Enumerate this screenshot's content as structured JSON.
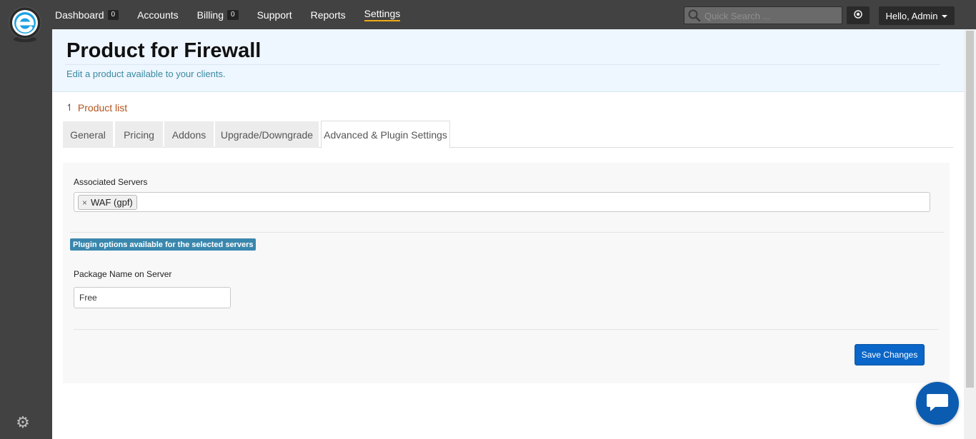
{
  "colors": {
    "accent": "#0a66c8",
    "nav_active_underline": "#f0a818",
    "info_badge": "#3a87ad",
    "link": "#b3541e",
    "subtitle": "#3a8aa0",
    "chat": "#0b5cb0"
  },
  "icons": {
    "logo": "e-logo-icon",
    "search": "magnifier-icon",
    "control": "target-icon",
    "settings": "gear-icon",
    "chat": "chat-bubble-icon",
    "breadcrumb": "up-arrow-icon",
    "remove": "close-icon"
  },
  "nav": {
    "items": [
      {
        "label": "Dashboard",
        "badge": "0",
        "active": false
      },
      {
        "label": "Accounts",
        "badge": null,
        "active": false
      },
      {
        "label": "Billing",
        "badge": "0",
        "active": false
      },
      {
        "label": "Support",
        "badge": null,
        "active": false
      },
      {
        "label": "Reports",
        "badge": null,
        "active": false
      },
      {
        "label": "Settings",
        "badge": null,
        "active": true
      }
    ],
    "search_placeholder": "Quick Search ...",
    "user_label": "Hello, Admin"
  },
  "header": {
    "title": "Product for Firewall",
    "subtitle": "Edit a product available to your clients."
  },
  "breadcrumb": {
    "arrow": "↿",
    "label": "Product list"
  },
  "tabs": [
    {
      "label": "General",
      "active": false
    },
    {
      "label": "Pricing",
      "active": false
    },
    {
      "label": "Addons",
      "active": false
    },
    {
      "label": "Upgrade/Downgrade",
      "active": false
    },
    {
      "label": "Advanced & Plugin Settings",
      "active": true
    }
  ],
  "form": {
    "servers_label": "Associated Servers",
    "servers_selected": [
      {
        "label": "WAF (gpf)",
        "remove_glyph": "×"
      }
    ],
    "plugin_badge": "Plugin options available for the selected servers",
    "package_label": "Package Name on Server",
    "package_value": "Free",
    "save_label": "Save Changes"
  }
}
